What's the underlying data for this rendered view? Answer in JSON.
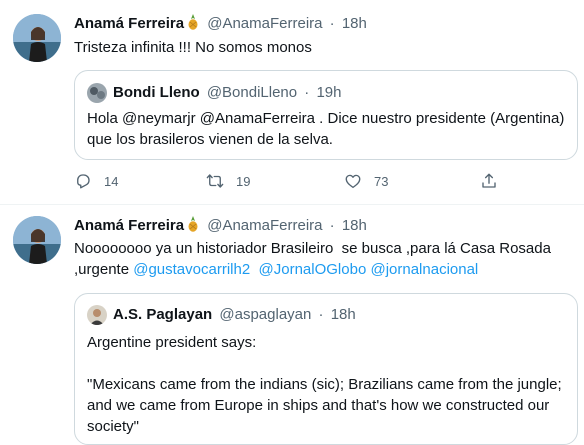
{
  "tweets": [
    {
      "author": "Anamá Ferreira",
      "handle": "@AnamaFerreira",
      "sep": "·",
      "time": "18h",
      "text": "Tristeza infinita !!! No somos monos",
      "quote": {
        "author": "Bondi Lleno",
        "handle": "@BondiLleno",
        "sep": "·",
        "time": "19h",
        "line1": "Hola @neymarjr @AnamaFerreira . Dice nuestro presidente (Argentina)",
        "line2": "que los brasileros vienen de la selva."
      },
      "replies": "14",
      "retweets": "19",
      "likes": "73"
    },
    {
      "author": "Anamá Ferreira",
      "handle": "@AnamaFerreira",
      "sep": "·",
      "time": "18h",
      "line1": "Noooooooo ya un historiador Brasileiro  se busca ,para lá Casa Rosada",
      "line2_prefix": ",urgente ",
      "mention1": "@gustavocarrilh2",
      "mention2": "@JornalOGlobo",
      "mention3": "@jornalnacional",
      "quote": {
        "author": "A.S. Paglayan",
        "handle": "@aspaglayan",
        "sep": "·",
        "time": "18h",
        "para1": "Argentine president says:",
        "para2_l1": "\"Mexicans came from the indians (sic); Brazilians came from the jungle;",
        "para2_l2": "and we came from Europe in ships and that's how we constructed our",
        "para2_l3": "society\""
      }
    }
  ],
  "icons": {
    "reply": "reply-icon",
    "retweet": "retweet-icon",
    "like": "heart-icon",
    "share": "share-icon"
  },
  "colors": {
    "link": "#1d9bf0",
    "muted": "#536471",
    "border": "#cfd9de"
  }
}
